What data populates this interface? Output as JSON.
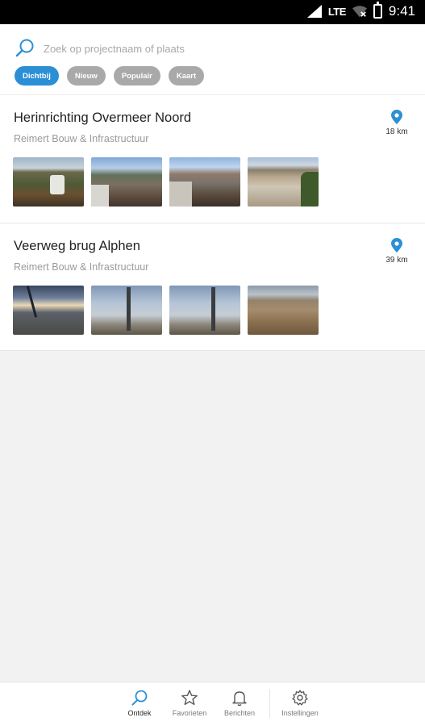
{
  "status_bar": {
    "network": "LTE",
    "time": "9:41"
  },
  "search": {
    "placeholder": "Zoek op projectnaam of plaats"
  },
  "filters": [
    {
      "label": "Dichtbij",
      "active": true
    },
    {
      "label": "Nieuw",
      "active": false
    },
    {
      "label": "Populair",
      "active": false
    },
    {
      "label": "Kaart",
      "active": false
    }
  ],
  "projects": [
    {
      "title": "Herinrichting Overmeer Noord",
      "company": "Reimert Bouw & Infrastructuur",
      "distance": "18 km"
    },
    {
      "title": "Veerweg brug Alphen",
      "company": "Reimert Bouw & Infrastructuur",
      "distance": "39 km"
    }
  ],
  "nav": [
    {
      "label": "Ontdek",
      "icon": "search-icon",
      "active": true
    },
    {
      "label": "Favorieten",
      "icon": "star-icon",
      "active": false
    },
    {
      "label": "Berichten",
      "icon": "bell-icon",
      "active": false
    },
    {
      "label": "Instellingen",
      "icon": "gear-icon",
      "active": false
    }
  ],
  "colors": {
    "accent": "#2b8fd6",
    "chip_inactive": "#a9a9a9"
  }
}
